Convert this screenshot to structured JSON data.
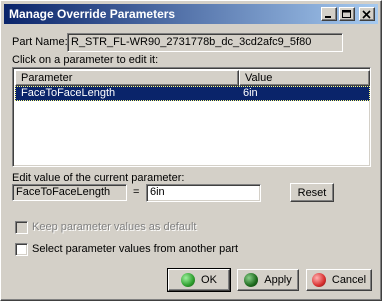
{
  "window": {
    "title": "Manage Override Parameters"
  },
  "part_name": {
    "label": "Part Name:",
    "value": "R_STR_FL-WR90_2731778b_dc_3cd2afc9_5f80"
  },
  "list": {
    "instruction": "Click on a parameter to edit it:",
    "columns": [
      "Parameter",
      "Value"
    ],
    "rows": [
      {
        "parameter": "FaceToFaceLength",
        "value": "6in",
        "selected": true
      }
    ]
  },
  "edit": {
    "label": "Edit value of the current parameter:",
    "param_name": "FaceToFaceLength",
    "equals": "=",
    "value": "6in",
    "reset_label": "Reset"
  },
  "options": {
    "keep_default_label": "Keep parameter values as default",
    "keep_default_enabled": false,
    "select_from_other_label": "Select parameter values from another part"
  },
  "buttons": {
    "ok": "OK",
    "apply": "Apply",
    "cancel": "Cancel"
  },
  "colors": {
    "title_start": "#0a246a",
    "title_end": "#a6caf0",
    "ok_dot": "#2e9e2e",
    "apply_dot": "#1d6a1d",
    "cancel_dot": "#d83030"
  }
}
